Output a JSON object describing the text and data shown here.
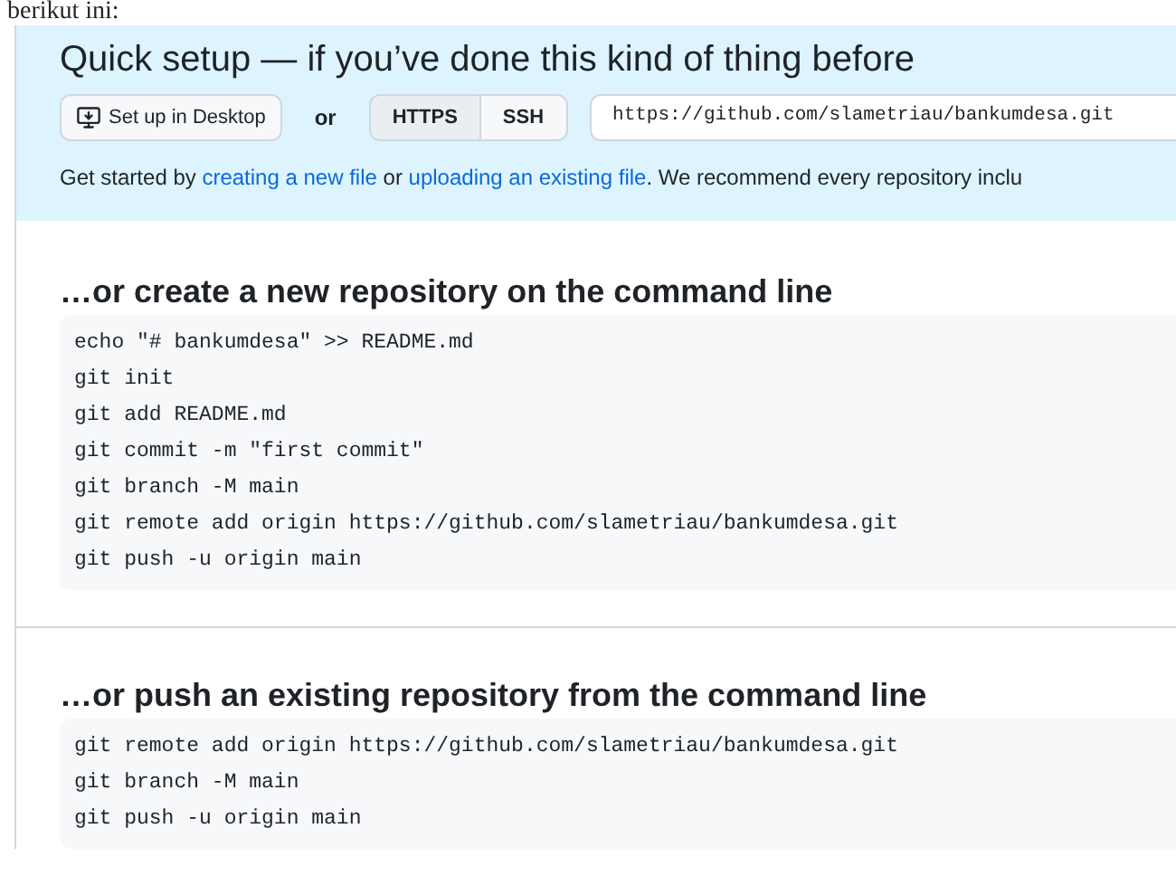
{
  "document_text": "berikut ini:",
  "quick_setup": {
    "title": "Quick setup — if you’ve done this kind of thing before",
    "desktop_button": "Set up in Desktop",
    "or": "or",
    "protocols": [
      {
        "label": "HTTPS",
        "selected": true
      },
      {
        "label": "SSH",
        "selected": false
      }
    ],
    "clone_url": "https://github.com/slametriau/bankumdesa.git",
    "hint": [
      {
        "kind": "text",
        "text": "Get started by "
      },
      {
        "kind": "link",
        "text": "creating a new file"
      },
      {
        "kind": "text",
        "text": " or "
      },
      {
        "kind": "link",
        "text": "uploading an existing file"
      },
      {
        "kind": "text",
        "text": ". We recommend every repository inclu"
      }
    ]
  },
  "sections": [
    {
      "title": "…or create a new repository on the command line",
      "lines": [
        "echo \"# bankumdesa\" >> README.md",
        "git init",
        "git add README.md",
        "git commit -m \"first commit\"",
        "git branch -M main",
        "git remote add origin https://github.com/slametriau/bankumdesa.git",
        "git push -u origin main"
      ]
    },
    {
      "title": "…or push an existing repository from the command line",
      "lines": [
        "git remote add origin https://github.com/slametriau/bankumdesa.git",
        "git branch -M main",
        "git push -u origin main"
      ]
    }
  ]
}
